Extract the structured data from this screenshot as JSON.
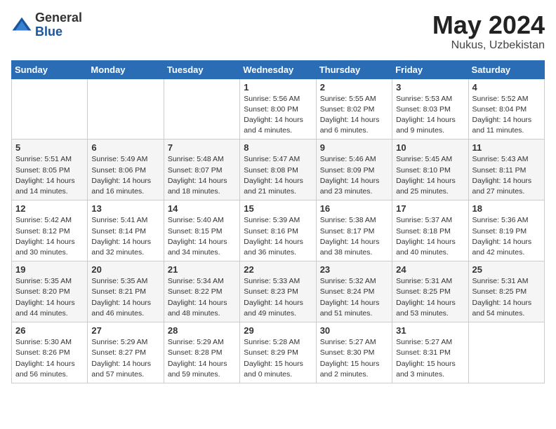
{
  "logo": {
    "general": "General",
    "blue": "Blue"
  },
  "title": {
    "month_year": "May 2024",
    "location": "Nukus, Uzbekistan"
  },
  "weekdays": [
    "Sunday",
    "Monday",
    "Tuesday",
    "Wednesday",
    "Thursday",
    "Friday",
    "Saturday"
  ],
  "weeks": [
    [
      {
        "day": "",
        "info": ""
      },
      {
        "day": "",
        "info": ""
      },
      {
        "day": "",
        "info": ""
      },
      {
        "day": "1",
        "info": "Sunrise: 5:56 AM\nSunset: 8:00 PM\nDaylight: 14 hours\nand 4 minutes."
      },
      {
        "day": "2",
        "info": "Sunrise: 5:55 AM\nSunset: 8:02 PM\nDaylight: 14 hours\nand 6 minutes."
      },
      {
        "day": "3",
        "info": "Sunrise: 5:53 AM\nSunset: 8:03 PM\nDaylight: 14 hours\nand 9 minutes."
      },
      {
        "day": "4",
        "info": "Sunrise: 5:52 AM\nSunset: 8:04 PM\nDaylight: 14 hours\nand 11 minutes."
      }
    ],
    [
      {
        "day": "5",
        "info": "Sunrise: 5:51 AM\nSunset: 8:05 PM\nDaylight: 14 hours\nand 14 minutes."
      },
      {
        "day": "6",
        "info": "Sunrise: 5:49 AM\nSunset: 8:06 PM\nDaylight: 14 hours\nand 16 minutes."
      },
      {
        "day": "7",
        "info": "Sunrise: 5:48 AM\nSunset: 8:07 PM\nDaylight: 14 hours\nand 18 minutes."
      },
      {
        "day": "8",
        "info": "Sunrise: 5:47 AM\nSunset: 8:08 PM\nDaylight: 14 hours\nand 21 minutes."
      },
      {
        "day": "9",
        "info": "Sunrise: 5:46 AM\nSunset: 8:09 PM\nDaylight: 14 hours\nand 23 minutes."
      },
      {
        "day": "10",
        "info": "Sunrise: 5:45 AM\nSunset: 8:10 PM\nDaylight: 14 hours\nand 25 minutes."
      },
      {
        "day": "11",
        "info": "Sunrise: 5:43 AM\nSunset: 8:11 PM\nDaylight: 14 hours\nand 27 minutes."
      }
    ],
    [
      {
        "day": "12",
        "info": "Sunrise: 5:42 AM\nSunset: 8:12 PM\nDaylight: 14 hours\nand 30 minutes."
      },
      {
        "day": "13",
        "info": "Sunrise: 5:41 AM\nSunset: 8:14 PM\nDaylight: 14 hours\nand 32 minutes."
      },
      {
        "day": "14",
        "info": "Sunrise: 5:40 AM\nSunset: 8:15 PM\nDaylight: 14 hours\nand 34 minutes."
      },
      {
        "day": "15",
        "info": "Sunrise: 5:39 AM\nSunset: 8:16 PM\nDaylight: 14 hours\nand 36 minutes."
      },
      {
        "day": "16",
        "info": "Sunrise: 5:38 AM\nSunset: 8:17 PM\nDaylight: 14 hours\nand 38 minutes."
      },
      {
        "day": "17",
        "info": "Sunrise: 5:37 AM\nSunset: 8:18 PM\nDaylight: 14 hours\nand 40 minutes."
      },
      {
        "day": "18",
        "info": "Sunrise: 5:36 AM\nSunset: 8:19 PM\nDaylight: 14 hours\nand 42 minutes."
      }
    ],
    [
      {
        "day": "19",
        "info": "Sunrise: 5:35 AM\nSunset: 8:20 PM\nDaylight: 14 hours\nand 44 minutes."
      },
      {
        "day": "20",
        "info": "Sunrise: 5:35 AM\nSunset: 8:21 PM\nDaylight: 14 hours\nand 46 minutes."
      },
      {
        "day": "21",
        "info": "Sunrise: 5:34 AM\nSunset: 8:22 PM\nDaylight: 14 hours\nand 48 minutes."
      },
      {
        "day": "22",
        "info": "Sunrise: 5:33 AM\nSunset: 8:23 PM\nDaylight: 14 hours\nand 49 minutes."
      },
      {
        "day": "23",
        "info": "Sunrise: 5:32 AM\nSunset: 8:24 PM\nDaylight: 14 hours\nand 51 minutes."
      },
      {
        "day": "24",
        "info": "Sunrise: 5:31 AM\nSunset: 8:25 PM\nDaylight: 14 hours\nand 53 minutes."
      },
      {
        "day": "25",
        "info": "Sunrise: 5:31 AM\nSunset: 8:25 PM\nDaylight: 14 hours\nand 54 minutes."
      }
    ],
    [
      {
        "day": "26",
        "info": "Sunrise: 5:30 AM\nSunset: 8:26 PM\nDaylight: 14 hours\nand 56 minutes."
      },
      {
        "day": "27",
        "info": "Sunrise: 5:29 AM\nSunset: 8:27 PM\nDaylight: 14 hours\nand 57 minutes."
      },
      {
        "day": "28",
        "info": "Sunrise: 5:29 AM\nSunset: 8:28 PM\nDaylight: 14 hours\nand 59 minutes."
      },
      {
        "day": "29",
        "info": "Sunrise: 5:28 AM\nSunset: 8:29 PM\nDaylight: 15 hours\nand 0 minutes."
      },
      {
        "day": "30",
        "info": "Sunrise: 5:27 AM\nSunset: 8:30 PM\nDaylight: 15 hours\nand 2 minutes."
      },
      {
        "day": "31",
        "info": "Sunrise: 5:27 AM\nSunset: 8:31 PM\nDaylight: 15 hours\nand 3 minutes."
      },
      {
        "day": "",
        "info": ""
      }
    ]
  ]
}
